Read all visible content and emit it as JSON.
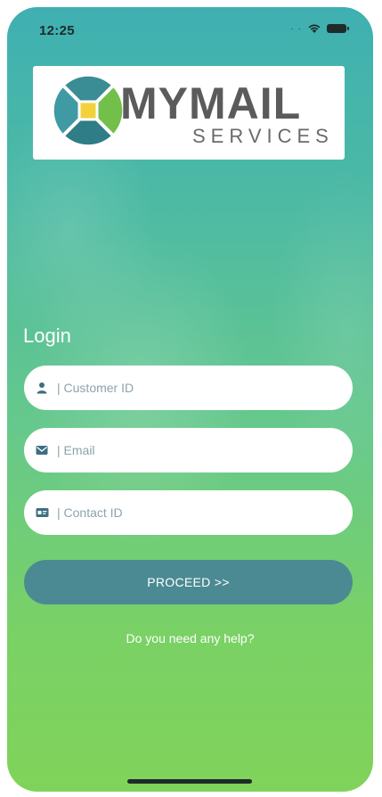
{
  "status_bar": {
    "time": "12:25",
    "icons": [
      "signal-dots-icon",
      "wifi-icon",
      "battery-icon"
    ]
  },
  "logo": {
    "title": "MYMAIL",
    "subtitle": "SERVICES",
    "colors": {
      "teal": "#3b8f94",
      "green": "#72c04a",
      "yellow": "#f2d13c",
      "dark": "#245e6a"
    }
  },
  "login": {
    "title": "Login",
    "fields": [
      {
        "icon": "person-icon",
        "placeholder": "| Customer ID",
        "value": ""
      },
      {
        "icon": "envelope-icon",
        "placeholder": "| Email",
        "value": ""
      },
      {
        "icon": "id-card-icon",
        "placeholder": "| Contact ID",
        "value": ""
      }
    ],
    "proceed_label": "PROCEED >>",
    "help_label": "Do you need any help?"
  },
  "theme": {
    "gradient_top": "#3fb0b1",
    "gradient_bottom": "#80d35a",
    "button": "#4b8a93",
    "icon_color": "#3e6e82"
  }
}
